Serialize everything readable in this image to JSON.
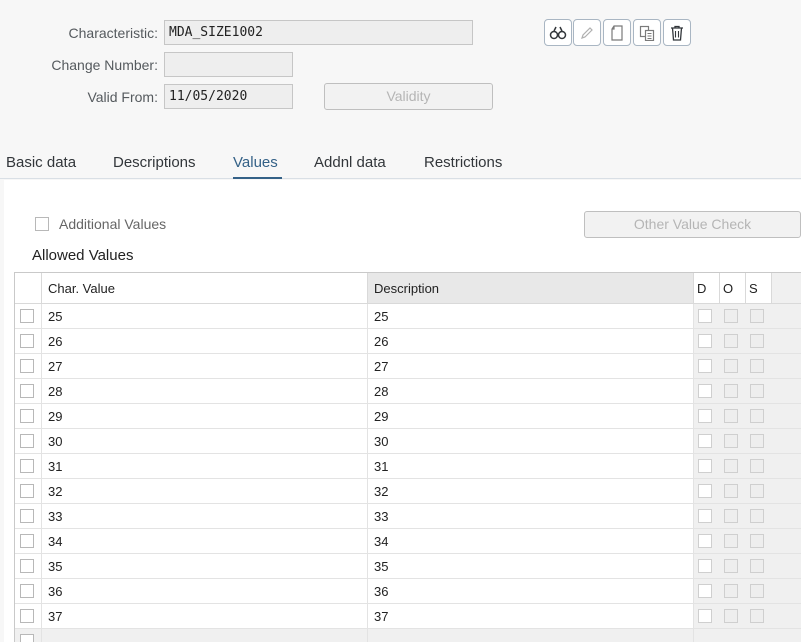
{
  "form": {
    "characteristic_label": "Characteristic:",
    "characteristic_value": "MDA_SIZE1002",
    "change_number_label": "Change Number:",
    "change_number_value": "",
    "valid_from_label": "Valid From:",
    "valid_from_value": "11/05/2020",
    "validity_button": "Validity"
  },
  "toolbar": {
    "icons": [
      "display-icon",
      "edit-icon",
      "create-icon",
      "copy-icon",
      "delete-icon"
    ]
  },
  "tabs": [
    {
      "label": "Basic data",
      "active": false
    },
    {
      "label": "Descriptions",
      "active": false
    },
    {
      "label": "Values",
      "active": true
    },
    {
      "label": "Addnl data",
      "active": false
    },
    {
      "label": "Restrictions",
      "active": false
    }
  ],
  "values_tab": {
    "additional_values_label": "Additional Values",
    "other_value_check_button": "Other Value Check",
    "allowed_values_title": "Allowed Values"
  },
  "table": {
    "headers": {
      "char_value": "Char. Value",
      "description": "Description",
      "d": "D",
      "o": "O",
      "s": "S"
    },
    "rows": [
      {
        "value": "25",
        "description": "25"
      },
      {
        "value": "26",
        "description": "26"
      },
      {
        "value": "27",
        "description": "27"
      },
      {
        "value": "28",
        "description": "28"
      },
      {
        "value": "29",
        "description": "29"
      },
      {
        "value": "30",
        "description": "30"
      },
      {
        "value": "31",
        "description": "31"
      },
      {
        "value": "32",
        "description": "32"
      },
      {
        "value": "33",
        "description": "33"
      },
      {
        "value": "34",
        "description": "34"
      },
      {
        "value": "35",
        "description": "35"
      },
      {
        "value": "36",
        "description": "36"
      },
      {
        "value": "37",
        "description": "37"
      }
    ]
  }
}
